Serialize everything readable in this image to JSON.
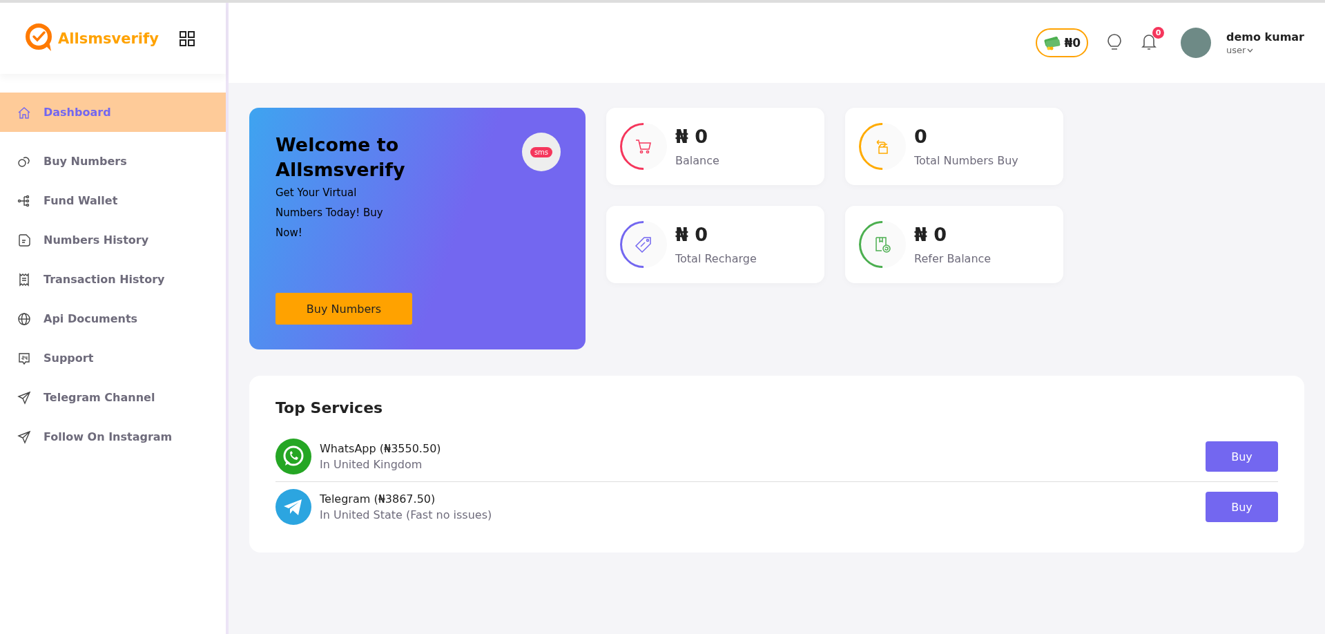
{
  "brand": {
    "name": "Allsmsverify"
  },
  "sidebar": {
    "items": [
      {
        "label": "Dashboard",
        "kind": "home",
        "selected": true
      },
      {
        "label": "Buy Numbers",
        "kind": "chat",
        "selected": false
      },
      {
        "label": "Fund Wallet",
        "kind": "tree",
        "selected": false
      },
      {
        "label": "Numbers History",
        "kind": "note",
        "selected": false
      },
      {
        "label": "Transaction History",
        "kind": "receipt",
        "selected": false
      },
      {
        "label": "Api Documents",
        "kind": "globe",
        "selected": false
      },
      {
        "label": "Support",
        "kind": "support",
        "selected": false
      },
      {
        "label": "Telegram Channel",
        "kind": "send",
        "selected": false
      },
      {
        "label": "Follow On Instagram",
        "kind": "send",
        "selected": false
      }
    ]
  },
  "header": {
    "wallet": "₦0",
    "notifications": "0",
    "user": {
      "name": "demo kumar",
      "role": "user"
    }
  },
  "welcome": {
    "title": "Welcome to Allsmsverify",
    "text": "Get Your Virtual Numbers Today! Buy Now!",
    "badge": "sms",
    "button": "Buy Numbers"
  },
  "stats": [
    {
      "value": "₦ 0",
      "label": "Balance",
      "kind": "cart",
      "color": "#f5365c"
    },
    {
      "value": "0",
      "label": "Total Numbers Buy",
      "kind": "box",
      "color": "#ffab00"
    },
    {
      "value": "₦ 0",
      "label": "Total Recharge",
      "kind": "tag",
      "color": "#7367f0"
    },
    {
      "value": "₦ 0",
      "label": "Refer Balance",
      "kind": "refer",
      "color": "#4caf50"
    }
  ],
  "top_services": {
    "title": "Top Services",
    "items": [
      {
        "name": "WhatsApp (₦3550.50)",
        "detail": "In United Kingdom",
        "kind": "whatsapp",
        "button": "Buy"
      },
      {
        "name": "Telegram (₦3867.50)",
        "detail": "In United State (Fast no issues)",
        "kind": "telegram",
        "button": "Buy"
      }
    ]
  }
}
